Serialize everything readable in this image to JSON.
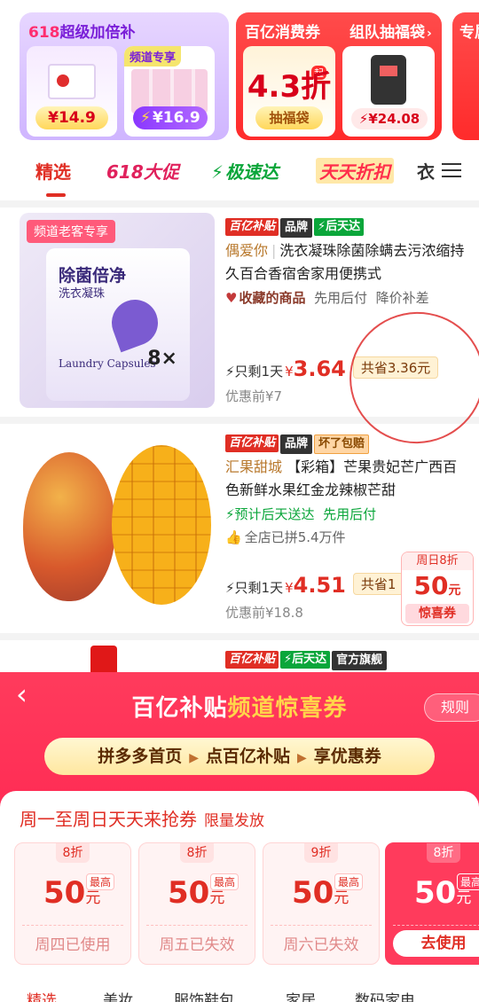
{
  "promos": {
    "card1": {
      "title_num": "618",
      "title_text": "超级加倍补",
      "item_a_price": "¥14.9",
      "item_b_tag": "频道专享",
      "item_b_price": "¥16.9"
    },
    "card2": {
      "title": "百亿消费券",
      "title2": "组队抽福袋",
      "discount": "4.3折",
      "qi": "起",
      "button": "抽福袋",
      "item_price": "¥24.08"
    },
    "card3": {
      "title": "专属"
    }
  },
  "tabs": [
    "精选",
    "618大促",
    "极速达",
    "天天折扣",
    "衣"
  ],
  "products": [
    {
      "badge": "频道老客专享",
      "tags": [
        "百亿补贴",
        "品牌",
        "后天达"
      ],
      "shop": "偶爱你",
      "title": "洗衣凝珠除菌除螨去污浓缩持久百合香宿舍家用便携式",
      "meta": [
        "收藏的商品",
        "先用后付",
        "降价补差"
      ],
      "left": "只剩1天",
      "yen": "¥",
      "price": "3.64",
      "save": "共省3.36元",
      "orig": "优惠前¥7",
      "pack_title": "除菌倍净",
      "pack_sub": "洗衣凝珠",
      "pack_en": "Laundry Capsules",
      "pack_count": "8×"
    },
    {
      "tags": [
        "百亿补贴",
        "品牌",
        "坏了包赔"
      ],
      "shop": "汇果甜城",
      "title": "【彩箱】芒果贵妃芒广西百色新鲜水果红金龙辣椒芒甜",
      "meta1_a": "预计后天送达",
      "meta1_b": "先用后付",
      "meta2": "全店已拼5.4万件",
      "left": "只剩1天",
      "yen": "¥",
      "price": "4.51",
      "save": "共省1",
      "orig": "优惠前¥18.8",
      "coupon": {
        "top": "周日8折",
        "value": "50",
        "unit": "元",
        "btn": "惊喜券"
      }
    },
    {
      "tags": [
        "百亿补贴",
        "后天达",
        "官方旗舰"
      ]
    }
  ],
  "sheet": {
    "head_a": "百亿补贴",
    "head_b": "频道惊喜券",
    "rules": "规则",
    "steps": [
      "拼多多首页",
      "点百亿补贴",
      "享优惠券"
    ],
    "panel_title": "周一至周日天天来抢券",
    "limit": "限量发放",
    "coupons": [
      {
        "disc": "8折",
        "max": "最高",
        "value": "50",
        "unit": "元",
        "status": "周四已使用"
      },
      {
        "disc": "8折",
        "max": "最高",
        "value": "50",
        "unit": "元",
        "status": "周五已失效"
      },
      {
        "disc": "9折",
        "max": "最高",
        "value": "50",
        "unit": "元",
        "status": "周六已失效"
      },
      {
        "disc": "8折",
        "max": "最高",
        "value": "50",
        "unit": "元",
        "status": "去使用"
      }
    ],
    "bottom_tabs": [
      "精选",
      "美妆",
      "服饰鞋包",
      "家居",
      "数码家电"
    ]
  },
  "colors": {
    "brand_red": "#e02e24",
    "sheet_red": "#ff3b5c",
    "green": "#0aa63a"
  }
}
